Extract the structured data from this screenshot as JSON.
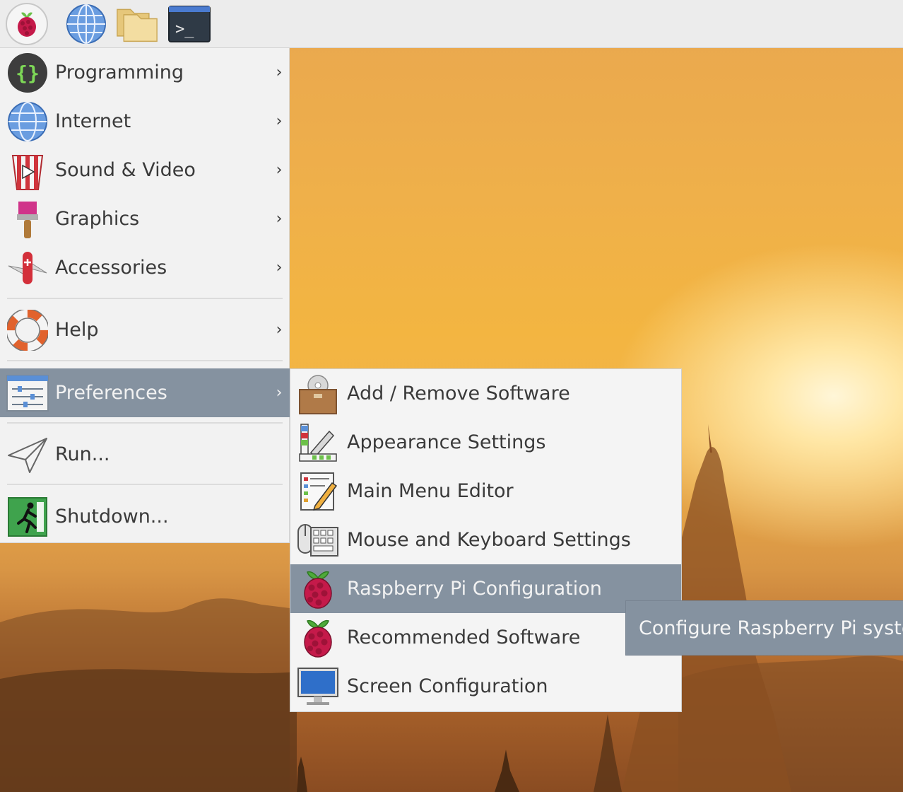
{
  "panel": {
    "launchers": [
      {
        "icon": "raspberry-icon"
      },
      {
        "icon": "globe-icon"
      },
      {
        "icon": "folder-icon"
      },
      {
        "icon": "terminal-icon",
        "glyph": ">_"
      }
    ]
  },
  "main_menu": {
    "items": [
      {
        "label": "Programming",
        "icon": "braces-icon",
        "arrow": "›"
      },
      {
        "label": "Internet",
        "icon": "globe-icon",
        "arrow": "›"
      },
      {
        "label": "Sound & Video",
        "icon": "popcorn-icon",
        "arrow": "›"
      },
      {
        "label": "Graphics",
        "icon": "paintbrush-icon",
        "arrow": "›"
      },
      {
        "label": "Accessories",
        "icon": "knife-icon",
        "arrow": "›"
      },
      {
        "label": "Help",
        "icon": "lifebuoy-icon",
        "arrow": "›"
      },
      {
        "label": "Preferences",
        "icon": "sliders-icon",
        "arrow": "›",
        "active": true
      },
      {
        "label": "Run...",
        "icon": "paper-plane-icon"
      },
      {
        "label": "Shutdown...",
        "icon": "exit-icon"
      }
    ]
  },
  "sub_menu": {
    "items": [
      {
        "label": "Add / Remove Software",
        "icon": "package-icon"
      },
      {
        "label": "Appearance Settings",
        "icon": "palette-icon"
      },
      {
        "label": "Main Menu Editor",
        "icon": "menu-editor-icon"
      },
      {
        "label": "Mouse and Keyboard Settings",
        "icon": "keyboard-mouse-icon"
      },
      {
        "label": "Raspberry Pi Configuration",
        "icon": "raspberry-icon",
        "active": true
      },
      {
        "label": "Recommended Software",
        "icon": "raspberry-icon"
      },
      {
        "label": "Screen Configuration",
        "icon": "monitor-icon"
      }
    ]
  },
  "tooltip": {
    "text": "Configure Raspberry Pi syste"
  },
  "colors": {
    "highlight": "#8592a0",
    "menu_bg": "#f2f2f2",
    "text": "#3a3a3a"
  }
}
